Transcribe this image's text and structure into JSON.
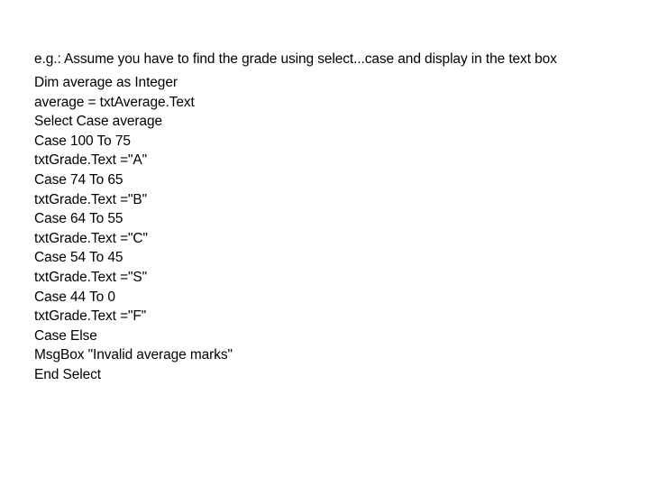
{
  "intro": "e.g.: Assume you have to find the grade using select...case and display in the text box",
  "code_lines": [
    "Dim average as Integer",
    "average = txtAverage.Text",
    "Select Case average",
    "Case 100 To 75",
    "txtGrade.Text =\"A\"",
    "Case 74 To 65",
    "txtGrade.Text =\"B\"",
    "Case 64 To 55",
    "txtGrade.Text =\"C\"",
    "Case 54 To 45",
    "txtGrade.Text =\"S\"",
    "Case 44 To 0",
    "txtGrade.Text =\"F\"",
    "Case Else",
    "MsgBox \"Invalid average marks\"",
    "End Select"
  ]
}
